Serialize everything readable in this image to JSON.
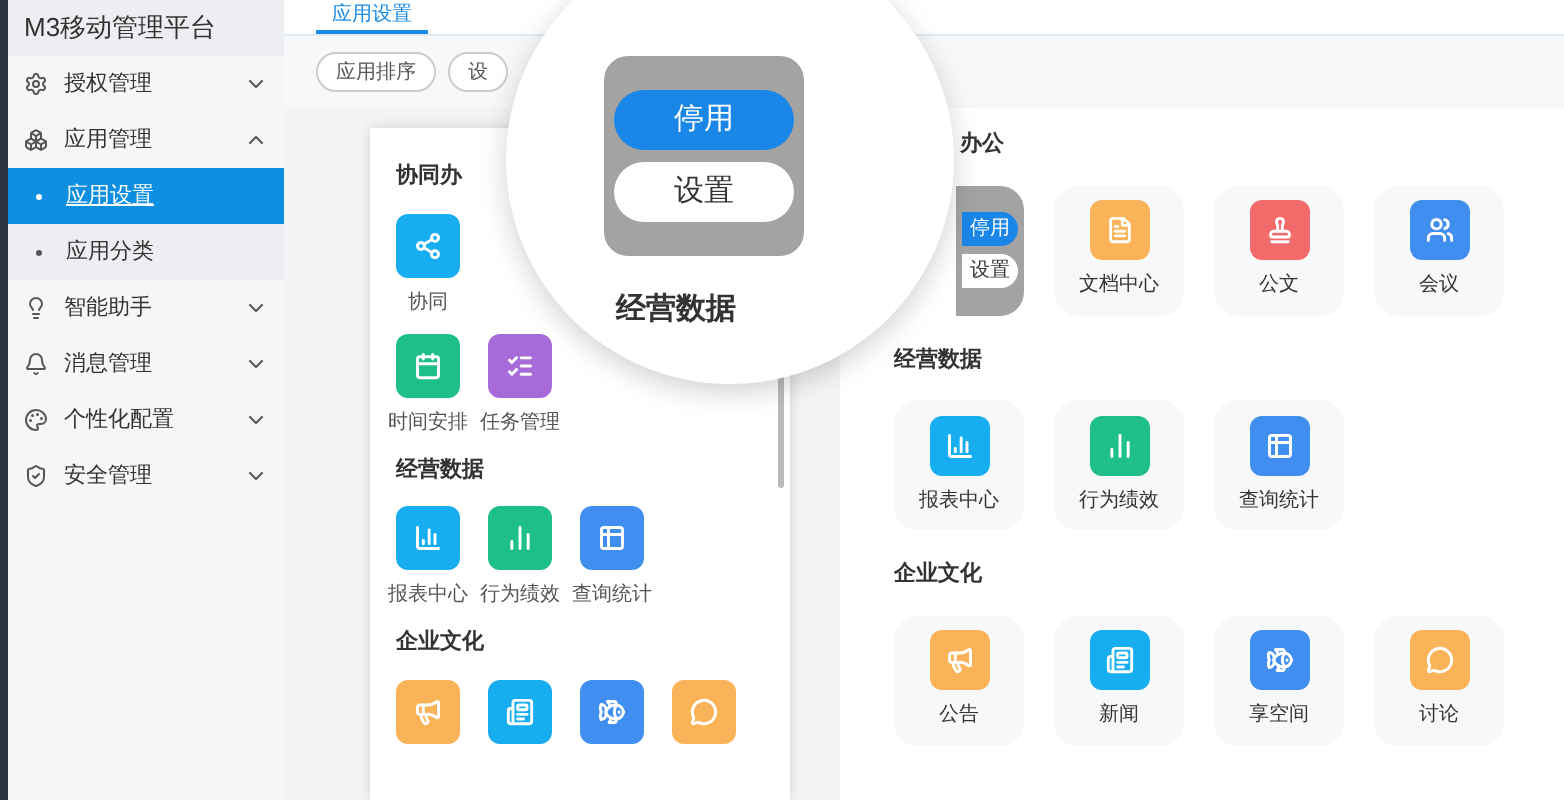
{
  "sidebar": {
    "title": "M3移动管理平台",
    "items": [
      {
        "label": "授权管理",
        "expanded": false
      },
      {
        "label": "应用管理",
        "expanded": true,
        "children": [
          {
            "label": "应用设置",
            "selected": true
          },
          {
            "label": "应用分类",
            "selected": false
          }
        ]
      },
      {
        "label": "智能助手",
        "expanded": false
      },
      {
        "label": "消息管理",
        "expanded": false
      },
      {
        "label": "个性化配置",
        "expanded": false
      },
      {
        "label": "安全管理",
        "expanded": false
      }
    ]
  },
  "tabs": [
    {
      "label": "应用设置",
      "selected": true
    }
  ],
  "toolbar": {
    "buttons": [
      "应用排序",
      "设"
    ]
  },
  "preview": {
    "sections": [
      {
        "title": "协同办",
        "rows": [
          [
            {
              "label": "协同",
              "color": "#16aef0"
            }
          ],
          [
            {
              "label": "时间安排",
              "color": "#1fbf8c"
            },
            {
              "label": "任务管理",
              "color": "#a66bd8"
            }
          ]
        ]
      },
      {
        "title": "经营数据",
        "rows": [
          [
            {
              "label": "报表中心",
              "color": "#16aef0"
            },
            {
              "label": "行为绩效",
              "color": "#1fbf8c"
            },
            {
              "label": "查询统计",
              "color": "#3f8ef0"
            }
          ]
        ]
      },
      {
        "title": "企业文化",
        "rows": [
          [
            {
              "color": "#fbb359"
            },
            {
              "color": "#16aef0"
            },
            {
              "color": "#3f8ef0"
            },
            {
              "color": "#fbb359"
            }
          ]
        ]
      }
    ]
  },
  "apps": {
    "sections": [
      {
        "title": "办公",
        "tiles": [
          {
            "hovered": true,
            "actions": [
              "停用",
              "设置"
            ]
          },
          {
            "label": "文档中心",
            "color": "#fbb359",
            "hovered": false
          },
          {
            "label": "公文",
            "color": "#f26a6a",
            "hovered": false
          },
          {
            "label": "会议",
            "color": "#3f8ef0",
            "hovered": false
          }
        ]
      },
      {
        "title": "经营数据",
        "tiles": [
          {
            "label": "报表中心",
            "color": "#16aef0",
            "hovered": false
          },
          {
            "label": "行为绩效",
            "color": "#1fbf8c",
            "hovered": false
          },
          {
            "label": "查询统计",
            "color": "#3f8ef0",
            "hovered": false
          }
        ]
      },
      {
        "title": "企业文化",
        "tiles": [
          {
            "label": "公告",
            "color": "#fbb359",
            "hovered": false
          },
          {
            "label": "新闻",
            "color": "#16aef0",
            "hovered": false
          },
          {
            "label": "享空间",
            "color": "#3f8ef0",
            "hovered": false
          },
          {
            "label": "讨论",
            "color": "#fbb359",
            "hovered": false
          }
        ]
      }
    ]
  },
  "magnifier": {
    "actions": [
      "停用",
      "设置"
    ],
    "heading": "经营数据"
  }
}
